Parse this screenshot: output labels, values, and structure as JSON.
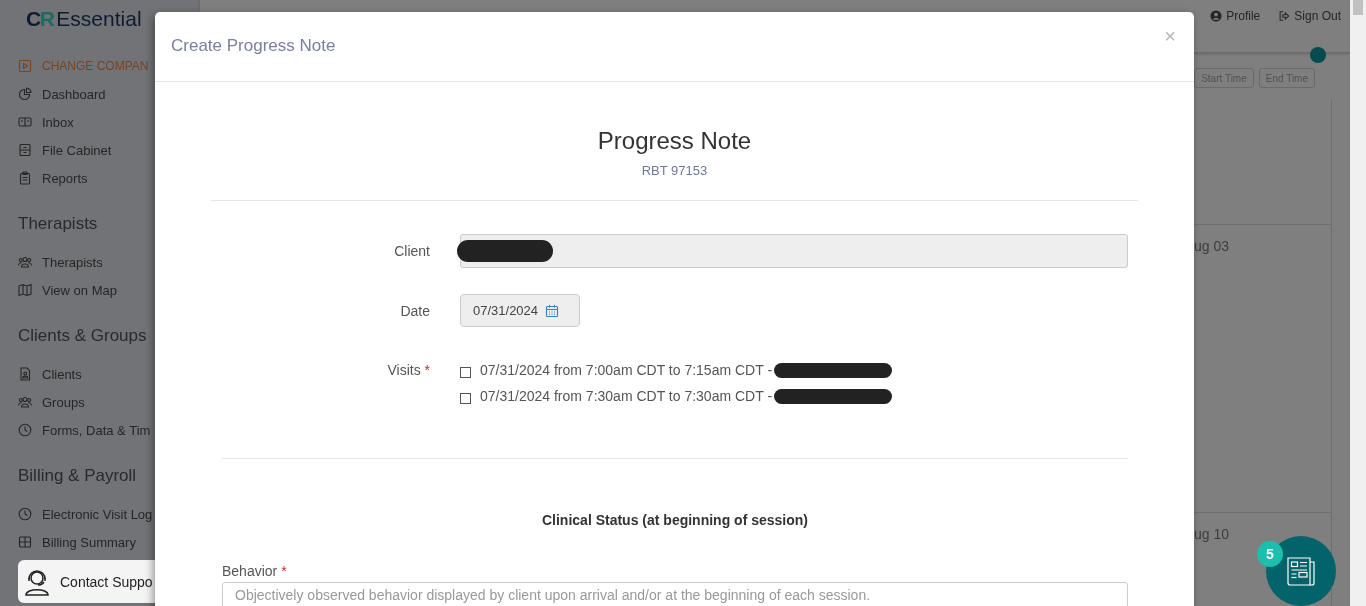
{
  "sidebar": {
    "logo": {
      "mark": "CR",
      "name": "Essential"
    },
    "groups": [
      {
        "items": [
          {
            "kind": "action",
            "label": "CHANGE COMPAN"
          },
          {
            "kind": "link",
            "label": "Dashboard"
          },
          {
            "kind": "link",
            "label": "Inbox"
          },
          {
            "kind": "link",
            "label": "File Cabinet"
          },
          {
            "kind": "link",
            "label": "Reports"
          }
        ]
      },
      {
        "heading": "Therapists",
        "items": [
          {
            "kind": "link",
            "label": "Therapists"
          },
          {
            "kind": "link",
            "label": "View on Map"
          }
        ]
      },
      {
        "heading": "Clients & Groups",
        "items": [
          {
            "kind": "link",
            "label": "Clients"
          },
          {
            "kind": "link",
            "label": "Groups"
          },
          {
            "kind": "link",
            "label": "Forms, Data & Tim"
          }
        ]
      },
      {
        "heading": "Billing & Payroll",
        "items": [
          {
            "kind": "link",
            "label": "Electronic Visit Log"
          },
          {
            "kind": "link",
            "label": "Billing Summary"
          }
        ]
      }
    ]
  },
  "contact_support": {
    "label": "Contact Suppo"
  },
  "topbar": {
    "links": [
      {
        "label": "Profile"
      },
      {
        "label": "Sign Out"
      }
    ]
  },
  "toolbar": {
    "buttons": [
      {
        "label": "Start Time"
      },
      {
        "label": "End Time"
      }
    ]
  },
  "calendar": {
    "weeks": [
      {
        "date": "ug 03"
      },
      {
        "date": "ug 10"
      }
    ]
  },
  "news_button": {
    "badge": "5"
  },
  "modal": {
    "title": "Create Progress Note",
    "close": "×",
    "heading": "Progress Note",
    "subheading": "RBT 97153",
    "fields": [
      {
        "kind": "readonly",
        "label": "Client",
        "redacted": true
      },
      {
        "kind": "date",
        "label": "Date",
        "value": "07/31/2024"
      },
      {
        "kind": "checklist",
        "label": "Visits",
        "required_mark": "*",
        "options": [
          {
            "label": "07/31/2024 from 7:00am CDT to 7:15am CDT -",
            "checked": false,
            "redacted": true
          },
          {
            "label": "07/31/2024 from 7:30am CDT to 7:30am CDT -",
            "checked": false,
            "redacted": true
          }
        ]
      }
    ],
    "section_title": "Clinical Status (at beginning of session)",
    "behavior": {
      "label": "Behavior",
      "required_mark": "*",
      "placeholder": "Objectively observed behavior displayed by client upon arrival and/or at the beginning of each session."
    }
  }
}
